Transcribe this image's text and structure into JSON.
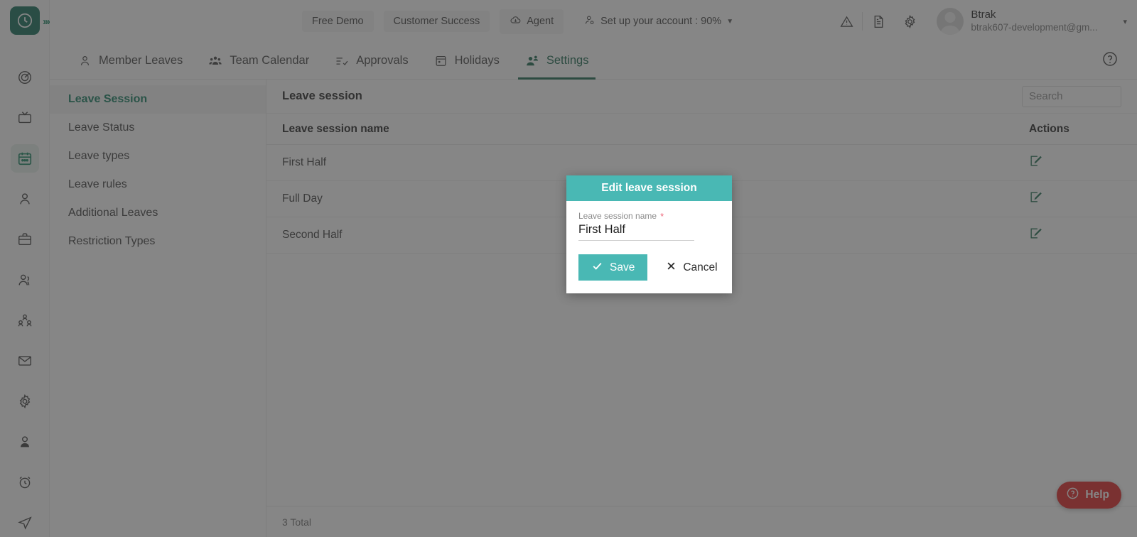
{
  "brand": {
    "logo_icon": "clock-logo-icon",
    "logo_color": "#0e6b56",
    "collapse_icon": "chevron-double-right-icon"
  },
  "rail": {
    "items": [
      {
        "icon": "target-icon",
        "active": false
      },
      {
        "icon": "tv-monitor-icon",
        "active": false
      },
      {
        "icon": "calendar-icon",
        "active": true
      },
      {
        "icon": "person-icon",
        "active": false
      },
      {
        "icon": "briefcase-icon",
        "active": false
      },
      {
        "icon": "users-icon",
        "active": false
      },
      {
        "icon": "org-chart-icon",
        "active": false
      },
      {
        "icon": "mail-icon",
        "active": false
      },
      {
        "icon": "gear-icon",
        "active": false
      },
      {
        "icon": "user-profile-icon",
        "active": false
      },
      {
        "icon": "alarm-clock-icon",
        "active": false
      },
      {
        "icon": "paper-plane-icon",
        "active": false
      }
    ],
    "active_color": "#12805e"
  },
  "header": {
    "chips": [
      {
        "label": "Free Demo",
        "icon": null
      },
      {
        "label": "Customer Success",
        "icon": null
      },
      {
        "label": "Agent",
        "icon": "cloud-download-icon"
      },
      {
        "label": "Set up your account : 90%",
        "icon": "account-setup-icon",
        "caret": true
      }
    ],
    "icons": [
      {
        "name": "warning-triangle-icon"
      },
      {
        "name": "document-icon"
      },
      {
        "name": "gear-icon"
      }
    ],
    "user": {
      "avatar_icon": "avatar",
      "name": "Btrak",
      "email": "btrak607-development@gm...",
      "caret": "▾"
    }
  },
  "tabs": {
    "items": [
      {
        "label": "Member Leaves",
        "icon": "person-icon",
        "active": false
      },
      {
        "label": "Team Calendar",
        "icon": "team-icon",
        "active": false
      },
      {
        "label": "Approvals",
        "icon": "approvals-icon",
        "active": false
      },
      {
        "label": "Holidays",
        "icon": "calendar-icon",
        "active": false
      },
      {
        "label": "Settings",
        "icon": "settings-users-icon",
        "active": true
      }
    ],
    "help_icon": "help-circle-icon",
    "active_color": "#15654a"
  },
  "subnav": {
    "items": [
      {
        "label": "Leave Session",
        "active": true
      },
      {
        "label": "Leave Status",
        "active": false
      },
      {
        "label": "Leave types",
        "active": false
      },
      {
        "label": "Leave rules",
        "active": false
      },
      {
        "label": "Additional Leaves",
        "active": false
      },
      {
        "label": "Restriction Types",
        "active": false
      }
    ]
  },
  "panel": {
    "title": "Leave session",
    "search": {
      "placeholder": "Search",
      "value": ""
    },
    "table": {
      "columns": [
        "Leave session name",
        "Actions"
      ],
      "rows": [
        {
          "name": "First Half",
          "action_icon": "edit-icon"
        },
        {
          "name": "Full Day",
          "action_icon": "edit-icon"
        },
        {
          "name": "Second Half",
          "action_icon": "edit-icon"
        }
      ]
    },
    "footer": "3 Total"
  },
  "help_fab": {
    "label": "Help",
    "icon": "help-circle-icon",
    "color": "#e02020"
  },
  "modal": {
    "title": "Edit leave session",
    "header_color": "#49b8b4",
    "field": {
      "label": "Leave session name",
      "required_marker": "*",
      "value": "First Half"
    },
    "save_label": "Save",
    "save_icon": "check-icon",
    "cancel_label": "Cancel",
    "cancel_icon": "close-x-icon"
  }
}
